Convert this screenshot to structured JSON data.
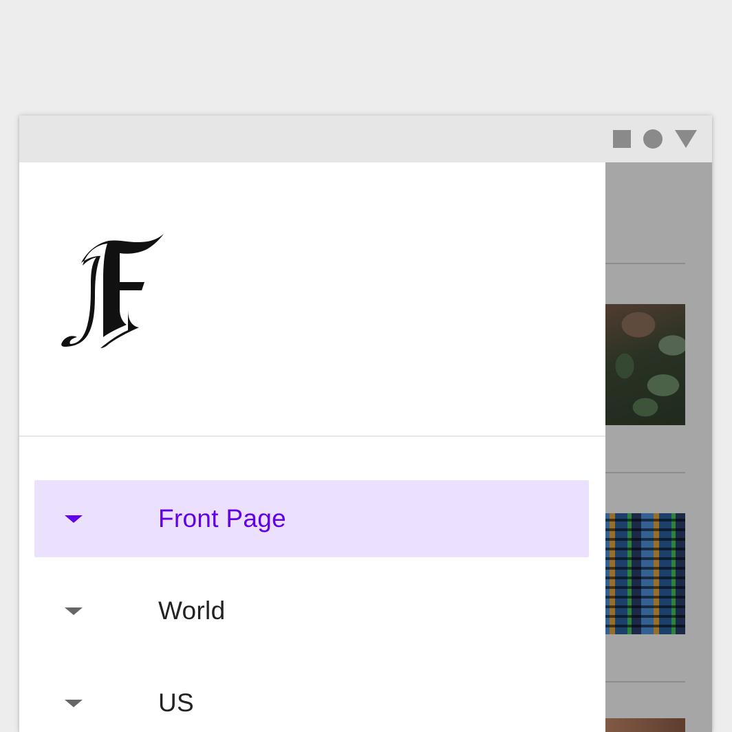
{
  "status_bar": {
    "icons": [
      "square-icon",
      "circle-icon",
      "triangle-icon"
    ],
    "color": "#8a8a8a"
  },
  "drawer": {
    "logo_icon": "blackletter-f-logo-icon",
    "nav_items": [
      {
        "label": "Front Page",
        "icon": "arrow-drop-down-icon",
        "active": true
      },
      {
        "label": "World",
        "icon": "arrow-drop-down-icon",
        "active": false
      },
      {
        "label": "US",
        "icon": "arrow-drop-down-icon",
        "active": false
      }
    ]
  },
  "colors": {
    "accent": "#6200ee",
    "active_background": "#ebe1ff",
    "text": "#222222",
    "scrim": "rgba(0,0,0,0.32)"
  }
}
